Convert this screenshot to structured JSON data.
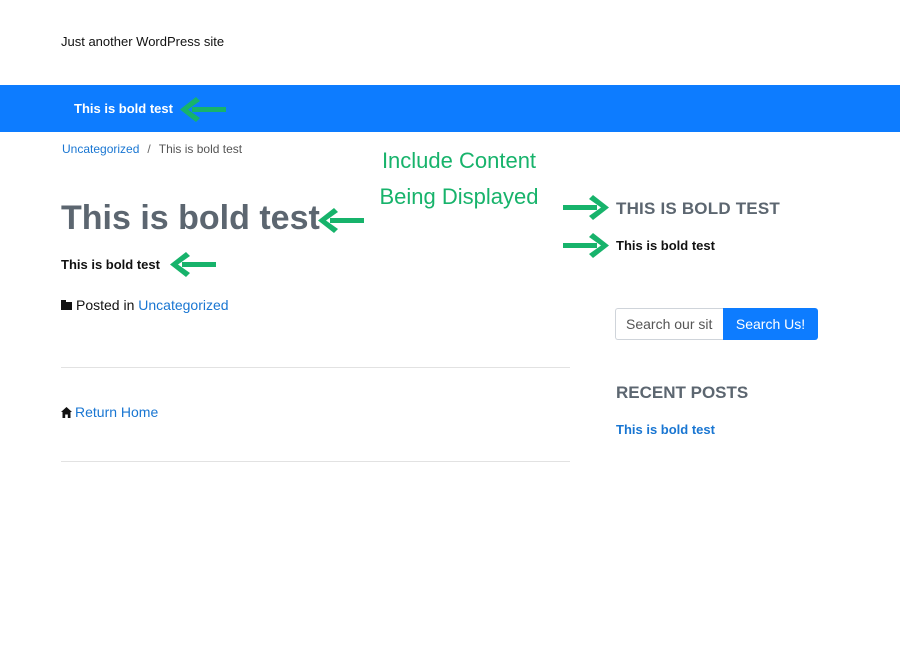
{
  "site": {
    "tagline": "Just another WordPress site"
  },
  "navbar": {
    "title": "This is bold test"
  },
  "breadcrumb": {
    "category": "Uncategorized",
    "separator": "/",
    "current": "This is bold test"
  },
  "post": {
    "title": "This is bold test",
    "content": "This is bold test",
    "posted_in_label": "Posted in",
    "category": "Uncategorized",
    "return_home": "Return Home"
  },
  "annotation": {
    "line1": "Include Content",
    "line2": "Being Displayed"
  },
  "sidebar": {
    "widget_title": "THIS IS BOLD TEST",
    "widget_text": "This is bold test",
    "search": {
      "placeholder": "Search our site",
      "button_label": "Search Us!"
    },
    "recent_posts": {
      "heading": "RECENT POSTS",
      "items": [
        "This is bold test"
      ]
    }
  },
  "colors": {
    "brand_blue": "#0d7cff",
    "arrow_green": "#17b36b",
    "link_blue": "#1976d2",
    "heading_gray": "#5c6670"
  },
  "icons": {
    "folder": "folder-icon",
    "home": "home-icon",
    "arrow": "left/right-arrow-annotation"
  }
}
